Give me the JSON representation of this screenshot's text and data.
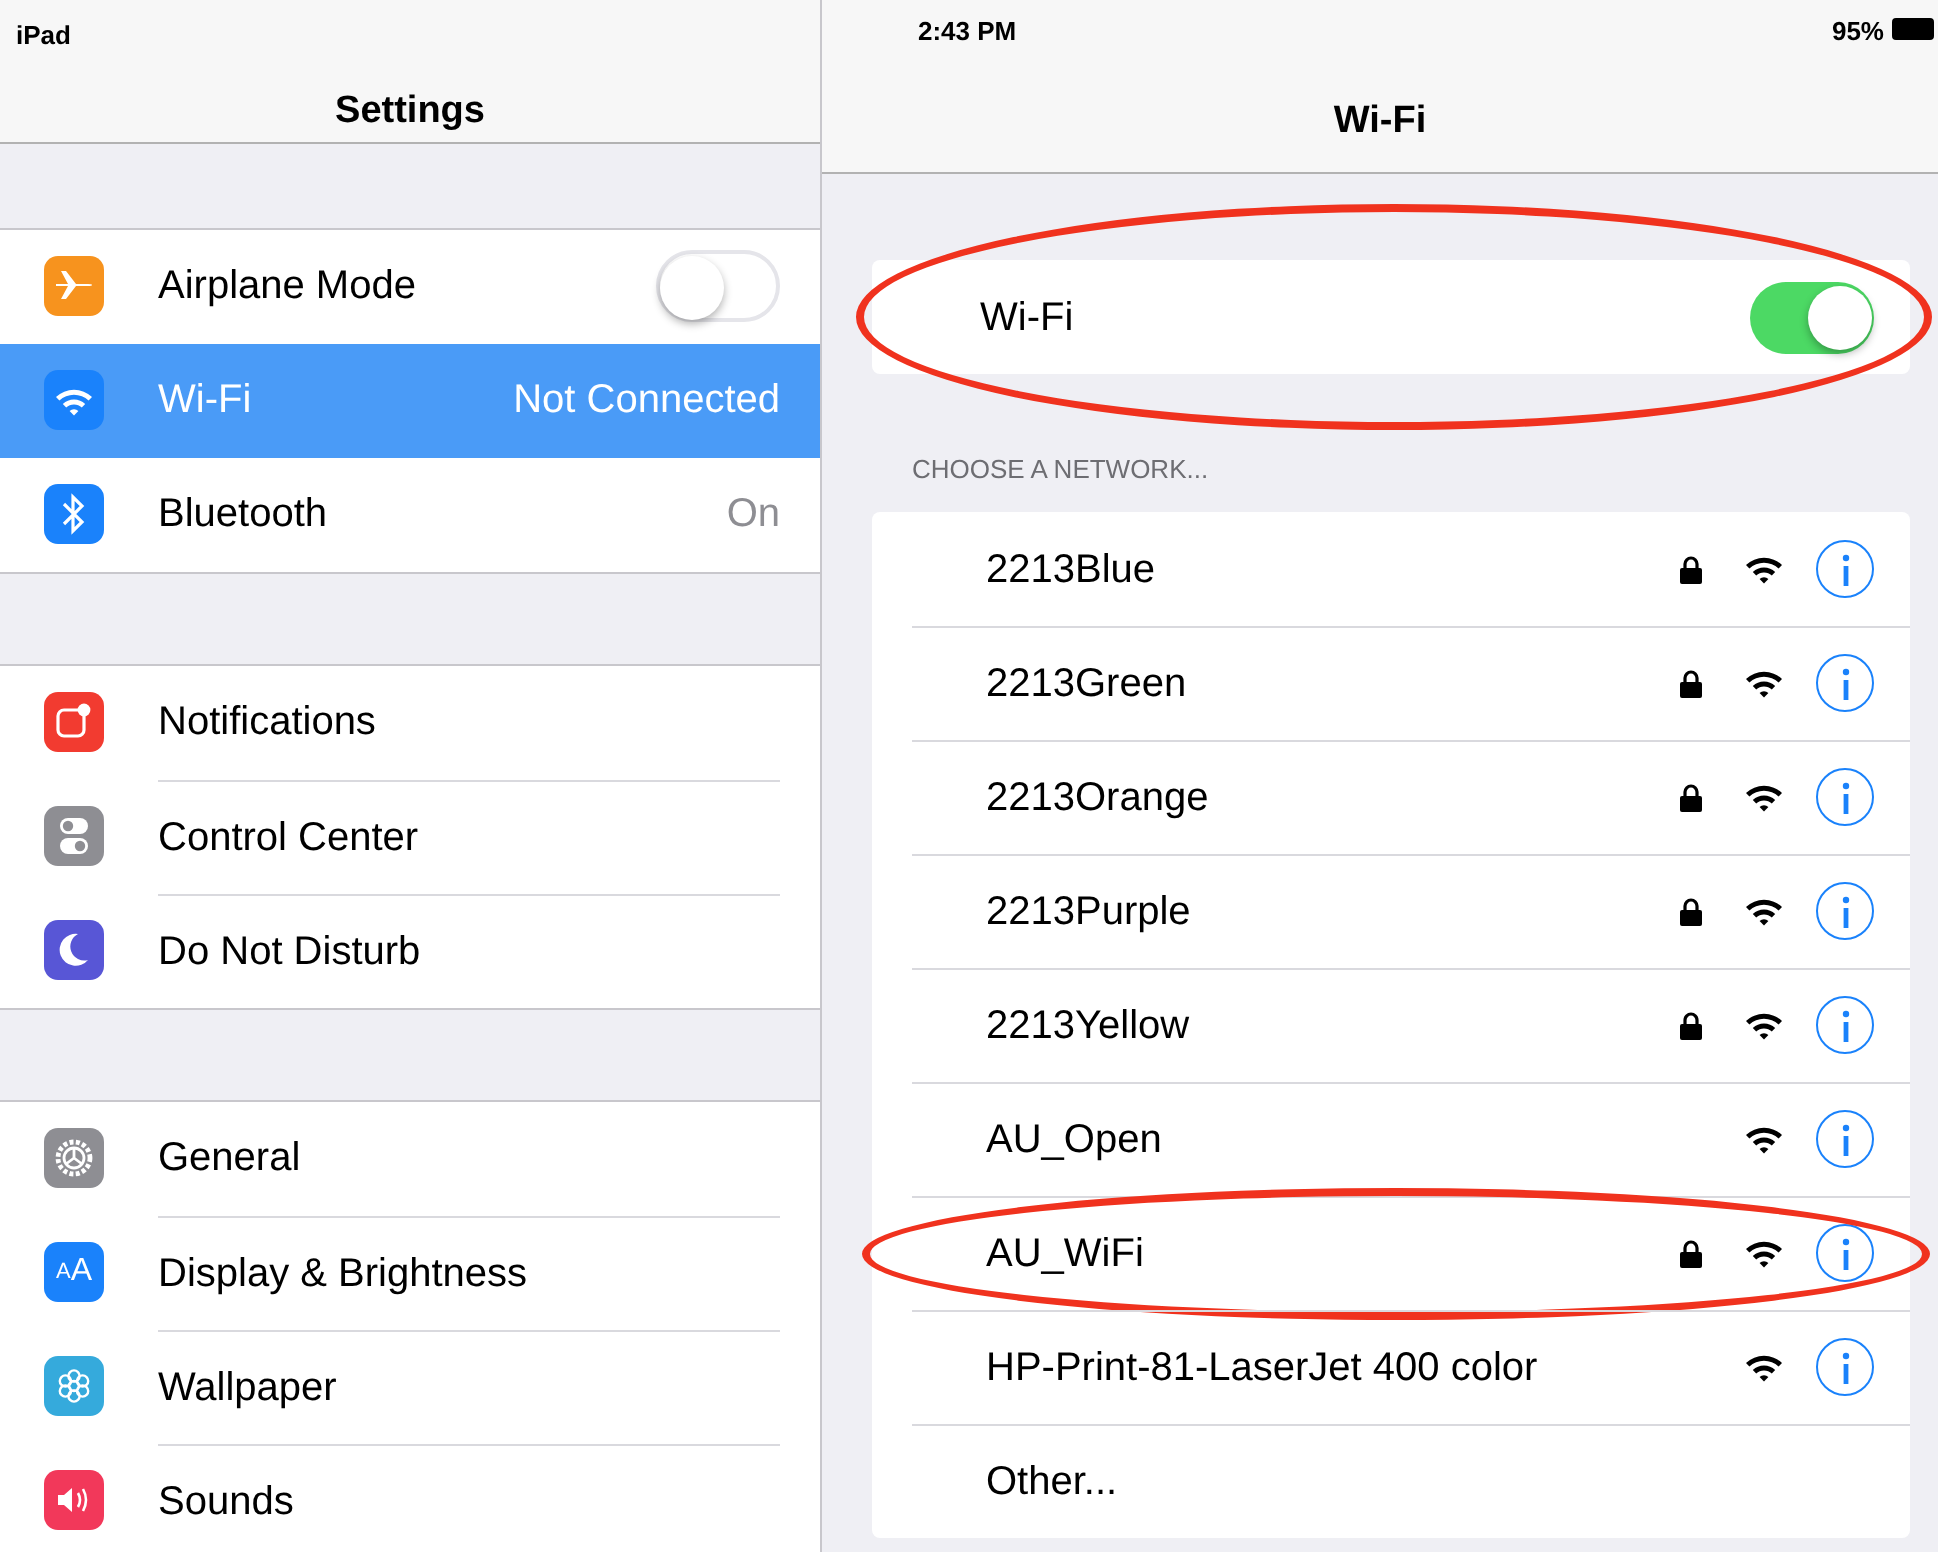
{
  "status_bar": {
    "device": "iPad",
    "time": "2:43 PM",
    "battery": "95%"
  },
  "sidebar": {
    "title": "Settings",
    "groups": [
      {
        "items": [
          {
            "label": "Airplane Mode",
            "kind": "toggle",
            "on": false,
            "selected": false
          },
          {
            "label": "Wi-Fi",
            "kind": "value",
            "value": "Not Connected",
            "selected": true
          },
          {
            "label": "Bluetooth",
            "kind": "value",
            "value": "On",
            "selected": false
          }
        ]
      },
      {
        "items": [
          {
            "label": "Notifications",
            "kind": "link",
            "selected": false
          },
          {
            "label": "Control Center",
            "kind": "link",
            "selected": false
          },
          {
            "label": "Do Not Disturb",
            "kind": "link",
            "selected": false
          }
        ]
      },
      {
        "items": [
          {
            "label": "General",
            "kind": "link",
            "selected": false
          },
          {
            "label": "Display & Brightness",
            "kind": "link",
            "icon_text": "AA",
            "selected": false
          },
          {
            "label": "Wallpaper",
            "kind": "link",
            "selected": false
          },
          {
            "label": "Sounds",
            "kind": "link",
            "selected": false
          }
        ]
      }
    ]
  },
  "detail": {
    "title": "Wi-Fi",
    "wifi_toggle": {
      "label": "Wi-Fi",
      "on": true,
      "circled": true
    },
    "section_header": "CHOOSE A NETWORK...",
    "networks": [
      {
        "name": "2213Blue",
        "kind": "network",
        "locked": true,
        "circled": false
      },
      {
        "name": "2213Green",
        "kind": "network",
        "locked": true,
        "circled": false
      },
      {
        "name": "2213Orange",
        "kind": "network",
        "locked": true,
        "circled": false
      },
      {
        "name": "2213Purple",
        "kind": "network",
        "locked": true,
        "circled": false
      },
      {
        "name": "2213Yellow",
        "kind": "network",
        "locked": true,
        "circled": false
      },
      {
        "name": "AU_Open",
        "kind": "network",
        "locked": false,
        "circled": false
      },
      {
        "name": "AU_WiFi",
        "kind": "network",
        "locked": true,
        "circled": true
      },
      {
        "name": "HP-Print-81-LaserJet 400 color",
        "kind": "network",
        "locked": false,
        "circled": false
      },
      {
        "name": "Other...",
        "kind": "other",
        "circled": false
      }
    ]
  }
}
